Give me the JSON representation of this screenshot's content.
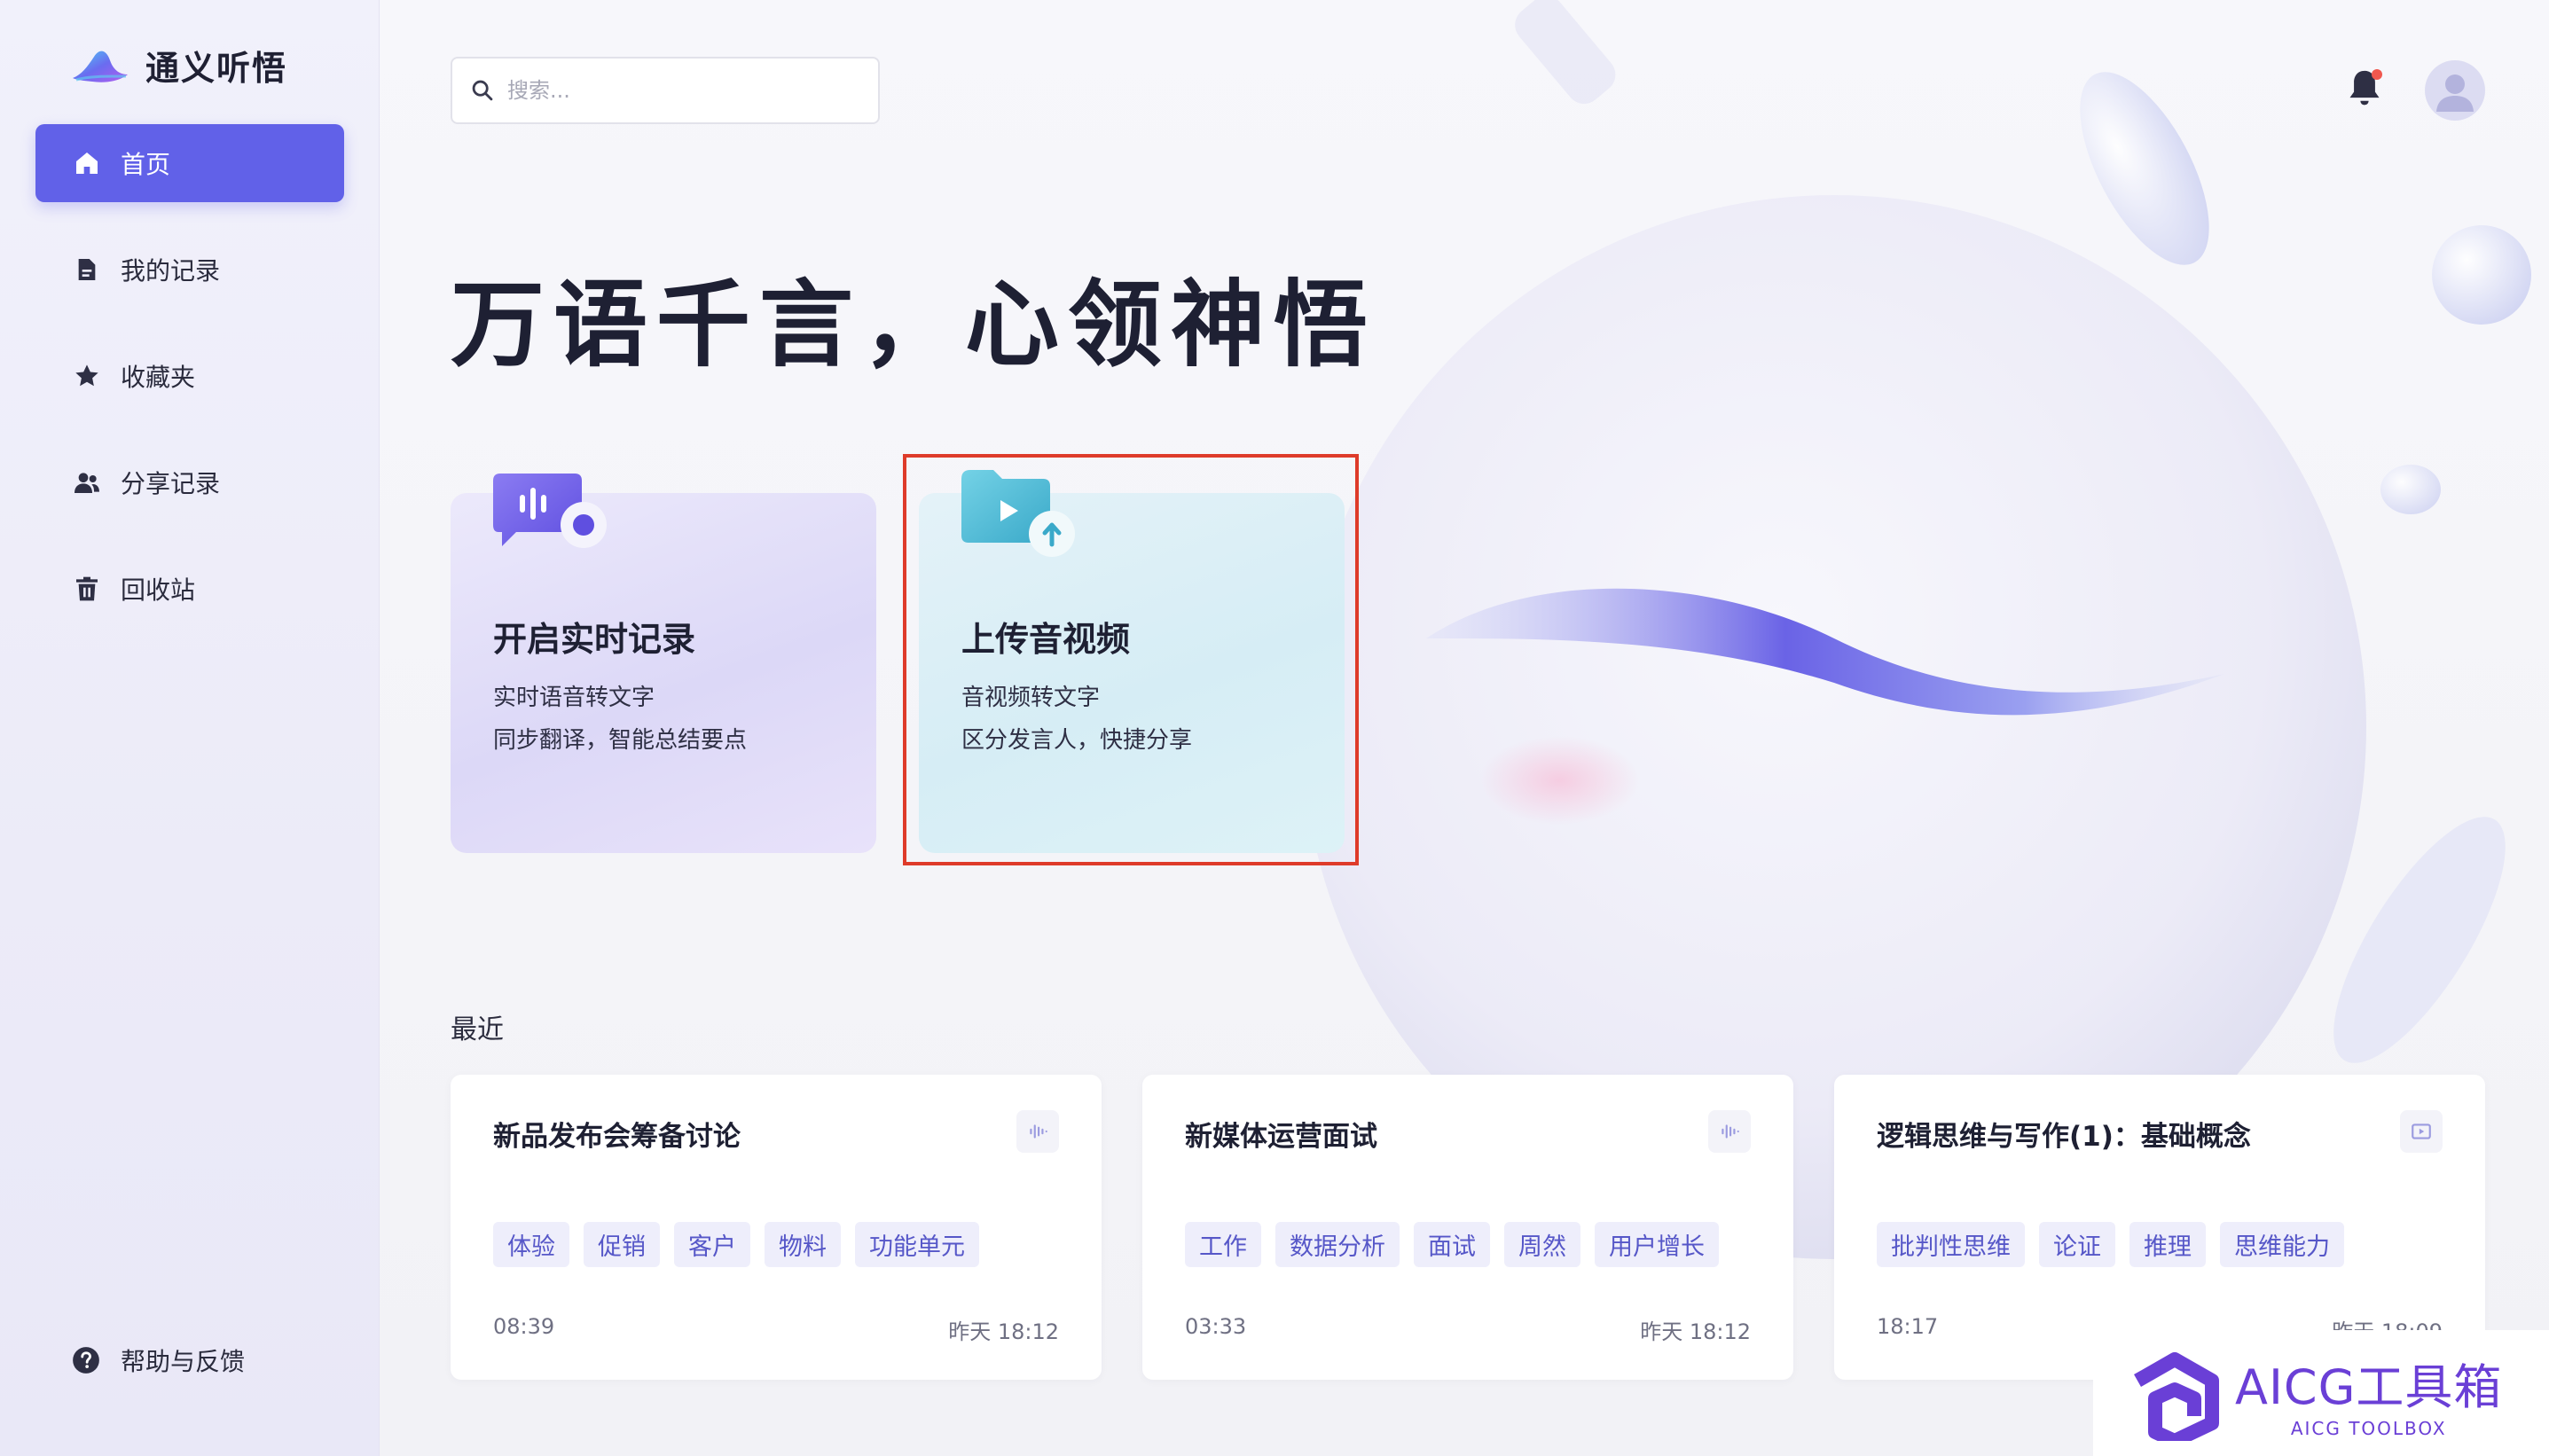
{
  "app": {
    "name": "通义听悟"
  },
  "sidebar": {
    "items": [
      {
        "label": "首页",
        "icon": "home-icon",
        "active": true
      },
      {
        "label": "我的记录",
        "icon": "document-icon",
        "active": false
      },
      {
        "label": "收藏夹",
        "icon": "star-icon",
        "active": false
      },
      {
        "label": "分享记录",
        "icon": "users-icon",
        "active": false
      },
      {
        "label": "回收站",
        "icon": "trash-icon",
        "active": false
      }
    ],
    "help_label": "帮助与反馈"
  },
  "search": {
    "placeholder": "搜索...",
    "value": ""
  },
  "header": {
    "notification_badge": true
  },
  "hero": {
    "title": "万语千言，心领神悟"
  },
  "cards": {
    "realtime": {
      "title": "开启实时记录",
      "line1": "实时语音转文字",
      "line2": "同步翻译，智能总结要点"
    },
    "upload": {
      "title": "上传音视频",
      "line1": "音视频转文字",
      "line2": "区分发言人，快捷分享"
    }
  },
  "recent": {
    "label": "最近",
    "items": [
      {
        "title": "新品发布会筹备讨论",
        "type_icon": "audio-wave-icon",
        "tags": [
          "体验",
          "促销",
          "客户",
          "物料",
          "功能单元"
        ],
        "duration": "08:39",
        "time": "昨天 18:12"
      },
      {
        "title": "新媒体运营面试",
        "type_icon": "audio-wave-icon",
        "tags": [
          "工作",
          "数据分析",
          "面试",
          "周然",
          "用户增长"
        ],
        "duration": "03:33",
        "time": "昨天 18:12"
      },
      {
        "title": "逻辑思维与写作(1)：基础概念",
        "type_icon": "video-icon",
        "tags": [
          "批判性思维",
          "论证",
          "推理",
          "思维能力"
        ],
        "duration": "18:17",
        "time": "昨天 18:09"
      }
    ]
  },
  "watermark": {
    "main": "AICG工具箱",
    "sub": "AICG TOOLBOX"
  },
  "colors": {
    "accent": "#6161e8",
    "highlight_border": "#de3b2a",
    "tag_text": "#5657c8",
    "tag_bg": "#eeeefb"
  }
}
